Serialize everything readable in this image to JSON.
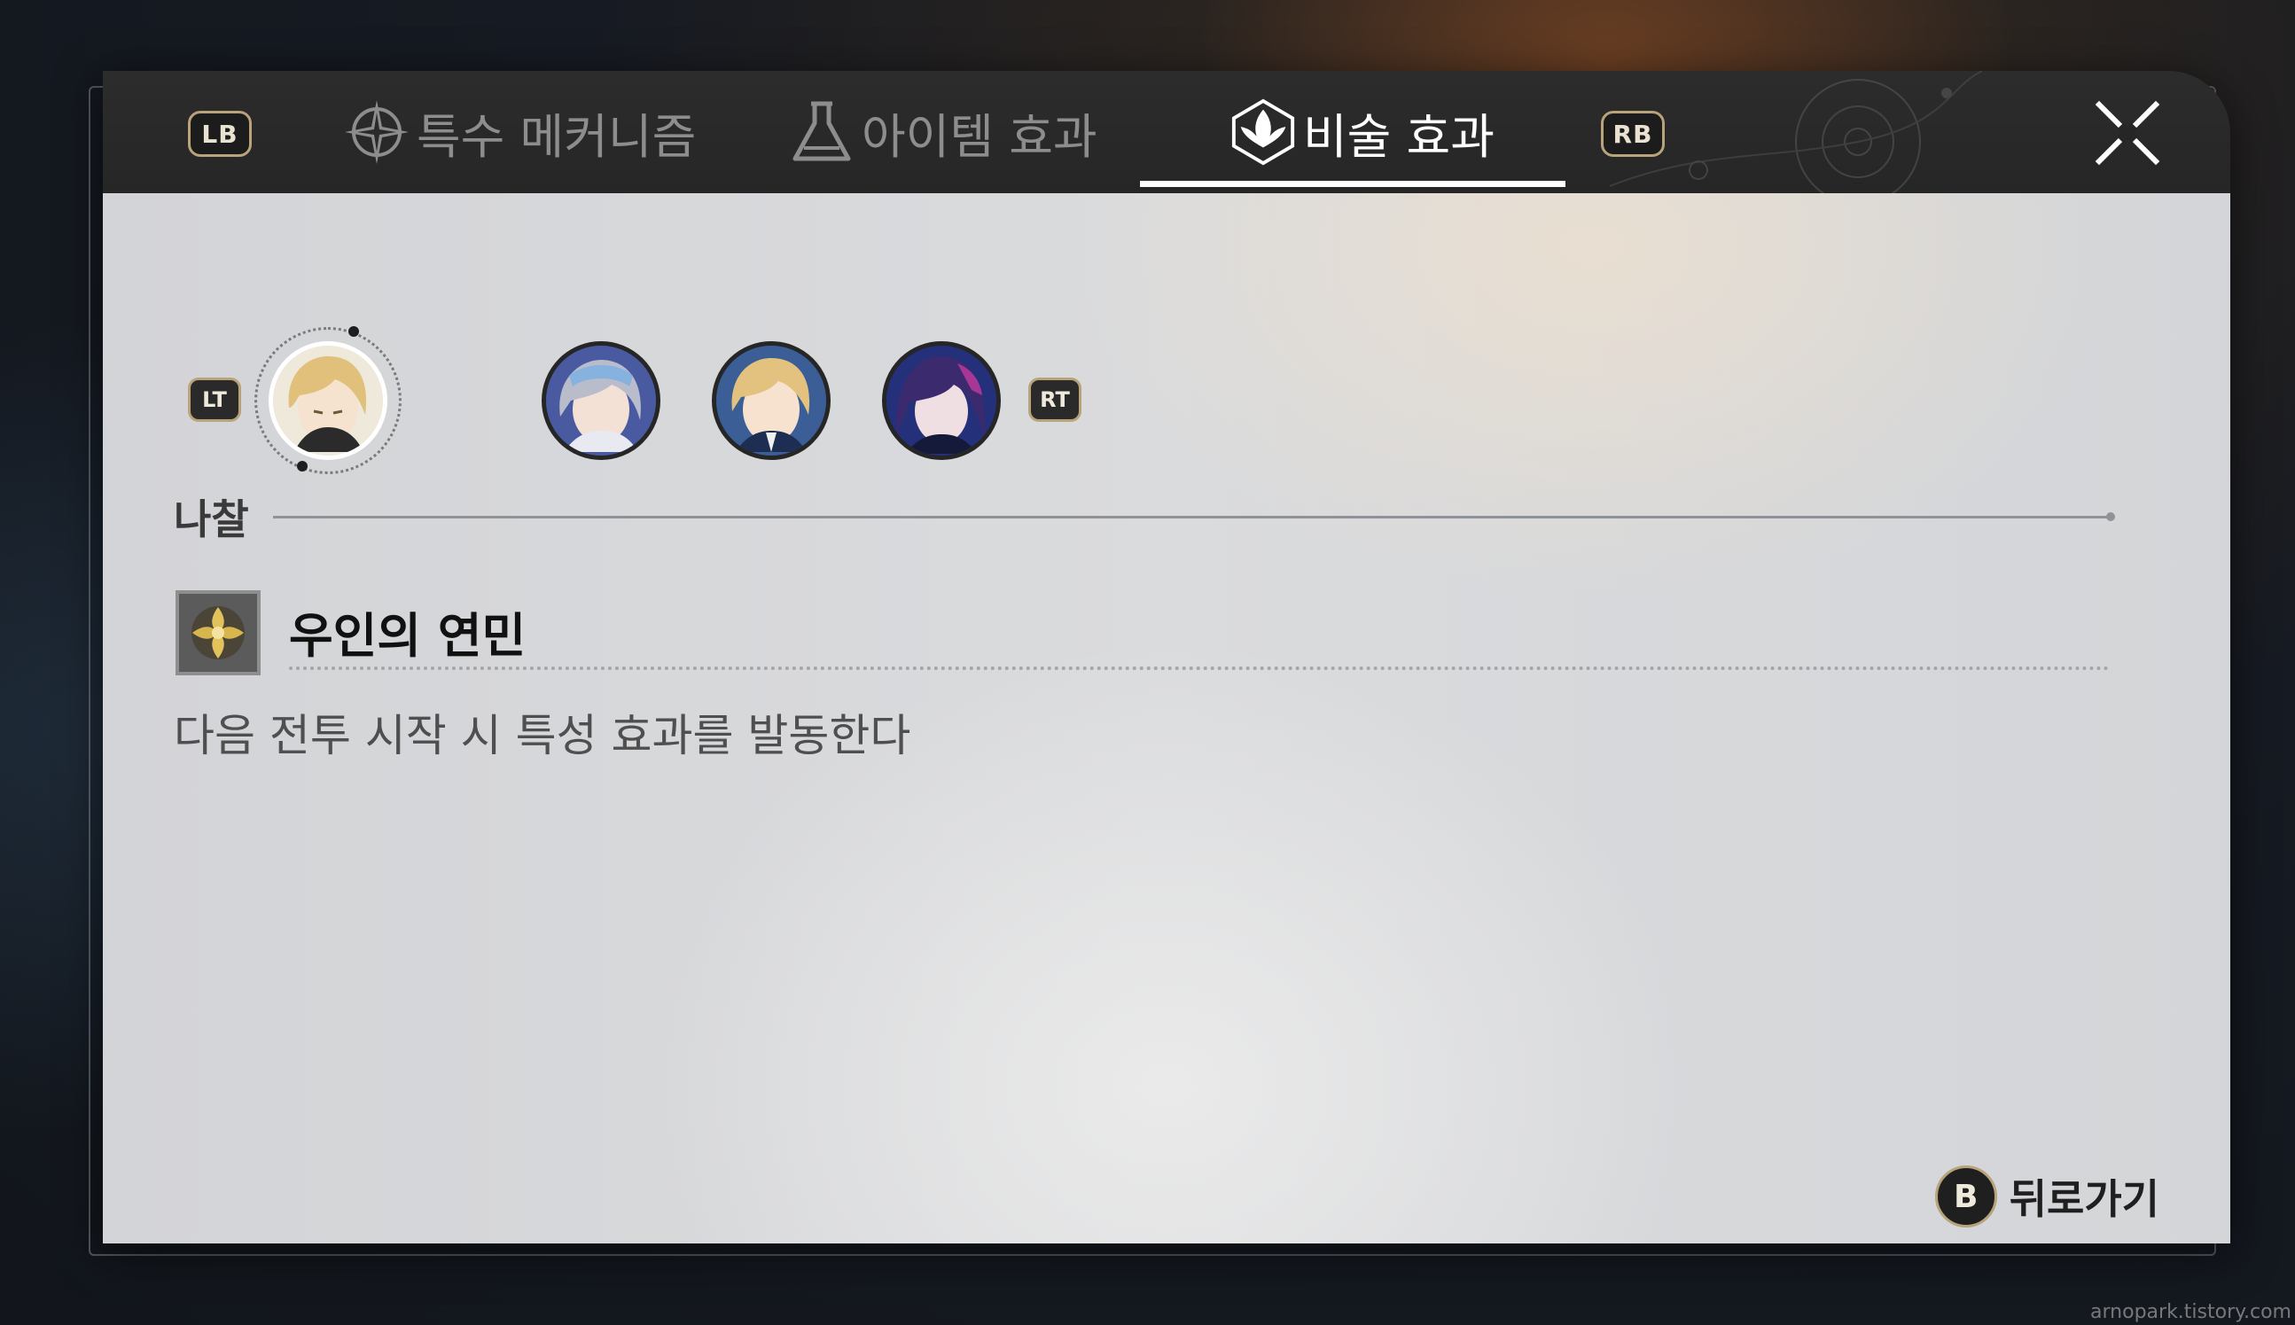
{
  "tabbar": {
    "lb_label": "LB",
    "rb_label": "RB",
    "tabs": [
      {
        "label": "특수 메커니즘",
        "icon": "compass-star-icon"
      },
      {
        "label": "아이템 효과",
        "icon": "flask-icon"
      },
      {
        "label": "비술 효과",
        "icon": "lotus-emblem-icon",
        "active": true
      }
    ],
    "close_icon": "close-x-icon"
  },
  "characters": {
    "lt_label": "LT",
    "rt_label": "RT",
    "avatars": [
      {
        "name": "avatar-1",
        "selected": true,
        "hair": "#e0c07a",
        "bg": "#f2efe7"
      },
      {
        "name": "avatar-2",
        "selected": false,
        "hair": "#b9bccb",
        "bg": "#3d4a86"
      },
      {
        "name": "avatar-3",
        "selected": false,
        "hair": "#e3c27f",
        "bg": "#2f4d7c"
      },
      {
        "name": "avatar-4",
        "selected": false,
        "hair": "#3b2a6e",
        "bg": "#1f2a6a"
      }
    ]
  },
  "section": {
    "title": "나찰"
  },
  "effect": {
    "name": "우인의 연민",
    "icon": "golden-flower-icon",
    "description": "다음 전투 시작 시 특성 효과를 발동한다"
  },
  "footer": {
    "back_key": "B",
    "back_label": "뒤로가기"
  },
  "watermark": "arnopark.tistory.com",
  "colors": {
    "accent_gold": "#b8a37a",
    "tab_active": "#ffffff",
    "tab_inactive": "#8d8d8d"
  }
}
